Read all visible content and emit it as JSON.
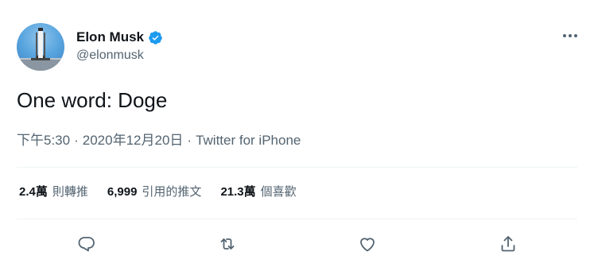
{
  "author": {
    "name": "Elon Musk",
    "handle": "@elonmusk",
    "avatar_icon": "rocket-launchpad-avatar",
    "verified_icon": "verified-badge-icon",
    "verified_color": "#1d9bf0"
  },
  "tweet": {
    "text": "One word: Doge",
    "time": "下午5:30",
    "date": "2020年12月20日",
    "separator": "·",
    "source": "Twitter for iPhone"
  },
  "stats": {
    "retweets_count": "2.4萬",
    "retweets_label": "則轉推",
    "quotes_count": "6,999",
    "quotes_label": "引用的推文",
    "likes_count": "21.3萬",
    "likes_label": "個喜歡"
  },
  "actions": {
    "reply_icon": "reply-icon",
    "retweet_icon": "retweet-icon",
    "like_icon": "heart-icon",
    "share_icon": "share-icon"
  },
  "colors": {
    "text_primary": "#0f1419",
    "text_secondary": "#536471",
    "divider": "#eff3f4"
  }
}
